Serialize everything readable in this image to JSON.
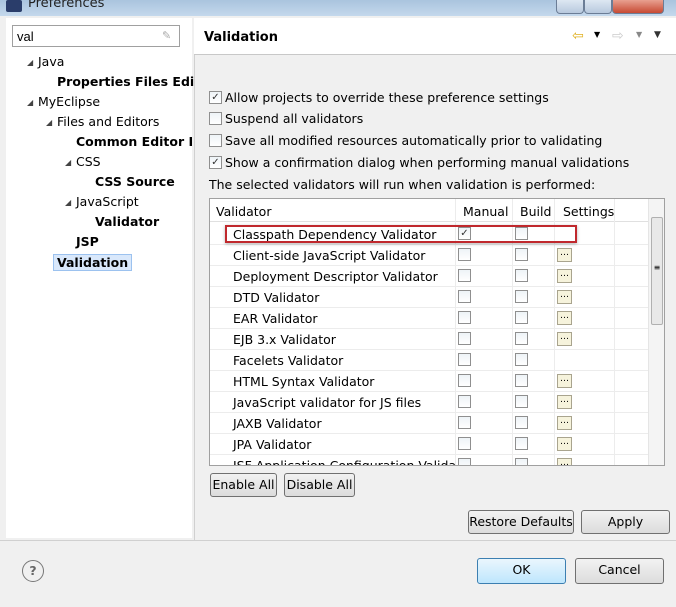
{
  "window": {
    "title": "Preferences"
  },
  "filter": {
    "value": "val"
  },
  "tree": [
    {
      "label": "Java",
      "bold": false,
      "expanded": true
    },
    {
      "label": "Properties Files Edit",
      "bold": true
    },
    {
      "label": "MyEclipse",
      "bold": false,
      "expanded": true
    },
    {
      "label": "Files and Editors",
      "bold": false,
      "expanded": true
    },
    {
      "label": "Common Editor I",
      "bold": true
    },
    {
      "label": "CSS",
      "bold": false,
      "expanded": true
    },
    {
      "label": "CSS Source",
      "bold": true
    },
    {
      "label": "JavaScript",
      "bold": false,
      "expanded": true
    },
    {
      "label": "Validator",
      "bold": true
    },
    {
      "label": "JSP",
      "bold": true
    },
    {
      "label": "Validation",
      "bold": true,
      "selected": true
    }
  ],
  "page": {
    "title": "Validation",
    "options": [
      {
        "label": "Allow projects to override these preference settings",
        "checked": true
      },
      {
        "label": "Suspend all validators",
        "checked": false
      },
      {
        "label": "Save all modified resources automatically prior to validating",
        "checked": false
      },
      {
        "label": "Show a confirmation dialog when performing manual validations",
        "checked": true
      }
    ],
    "info": "The selected validators will run when validation is performed:",
    "columns": [
      "Validator",
      "Manual",
      "Build",
      "Settings"
    ],
    "rows": [
      {
        "name": "Classpath Dependency Validator",
        "manual": true,
        "build": false,
        "settings": false,
        "highlighted": true
      },
      {
        "name": "Client-side JavaScript Validator",
        "manual": false,
        "build": false,
        "settings": true
      },
      {
        "name": "Deployment Descriptor Validator",
        "manual": false,
        "build": false,
        "settings": true
      },
      {
        "name": "DTD Validator",
        "manual": false,
        "build": false,
        "settings": true
      },
      {
        "name": "EAR Validator",
        "manual": false,
        "build": false,
        "settings": true
      },
      {
        "name": "EJB 3.x Validator",
        "manual": false,
        "build": false,
        "settings": true
      },
      {
        "name": "Facelets Validator",
        "manual": false,
        "build": false,
        "settings": false
      },
      {
        "name": "HTML Syntax Validator",
        "manual": false,
        "build": false,
        "settings": true
      },
      {
        "name": "JavaScript validator for JS files",
        "manual": false,
        "build": false,
        "settings": true
      },
      {
        "name": "JAXB Validator",
        "manual": false,
        "build": false,
        "settings": true
      },
      {
        "name": "JPA Validator",
        "manual": false,
        "build": false,
        "settings": true
      },
      {
        "name": "JSF Application Configuration Valida",
        "manual": false,
        "build": false,
        "settings": true
      }
    ],
    "enable_all": "Enable All",
    "disable_all": "Disable All",
    "restore_defaults": "Restore Defaults",
    "apply": "Apply"
  },
  "footer": {
    "ok": "OK",
    "cancel": "Cancel"
  },
  "colors": {
    "highlight": "#c0282d",
    "selection": "#d9e8fb"
  }
}
